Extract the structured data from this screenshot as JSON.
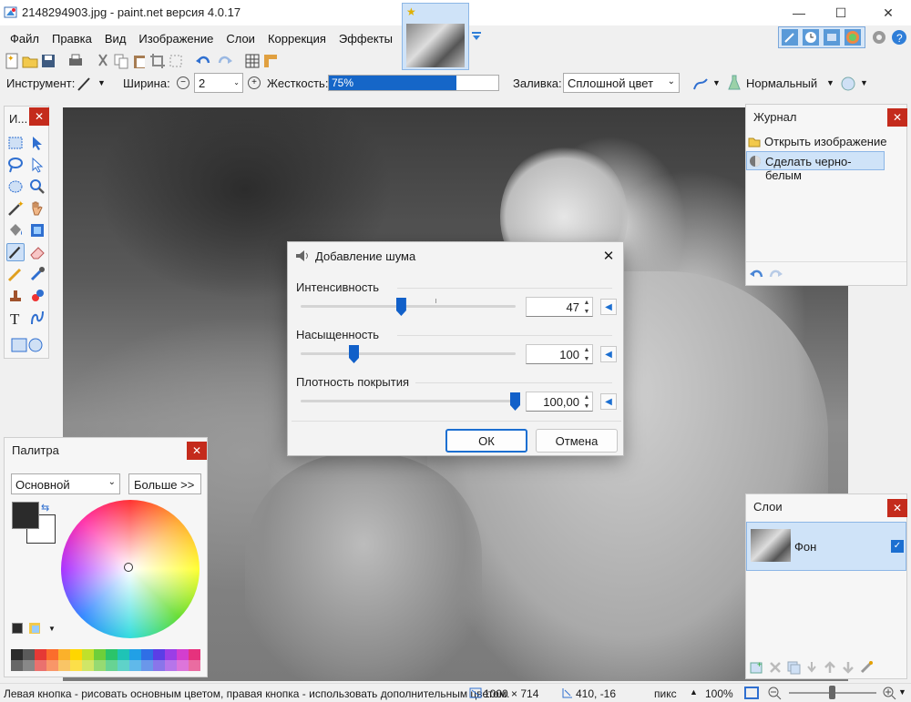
{
  "window": {
    "title": "2148294903.jpg - paint.net версия 4.0.17",
    "min": "—",
    "max": "☐",
    "close": "✕"
  },
  "menu": [
    "Файл",
    "Правка",
    "Вид",
    "Изображение",
    "Слои",
    "Коррекция",
    "Эффекты"
  ],
  "toolbar2": {
    "tool_label": "Инструмент:",
    "width_label": "Ширина:",
    "width_value": "2",
    "hardness_label": "Жесткость:",
    "hardness_value": "75%",
    "hardness_fraction": 0.75,
    "fill_label": "Заливка:",
    "fill_value": "Сплошной цвет",
    "blend_value": "Нормальный"
  },
  "tools_panel": {
    "title": "И...",
    "close": "✕"
  },
  "history": {
    "title": "Журнал",
    "close": "✕",
    "items": [
      "Открыть изображение",
      "Сделать черно-белым"
    ]
  },
  "palette": {
    "title": "Палитра",
    "close": "✕",
    "mode": "Основной",
    "more": "Больше >>",
    "colors": [
      "#2b2b2b",
      "#5a5a5a",
      "#e53935",
      "#fb6d2c",
      "#fbb12a",
      "#ffd600",
      "#c0e02b",
      "#6ecf3a",
      "#2bc46a",
      "#1fc3b6",
      "#21a0e6",
      "#2f6fe6",
      "#5b3ee6",
      "#9b3ee6",
      "#d33ecf",
      "#e6327d"
    ]
  },
  "layers": {
    "title": "Слои",
    "close": "✕",
    "items": [
      {
        "name": "Фон",
        "visible": true
      }
    ]
  },
  "dialog": {
    "title": "Добавление шума",
    "close": "✕",
    "params": [
      {
        "label": "Интенсивность",
        "value": "47",
        "fraction": 0.47
      },
      {
        "label": "Насыщенность",
        "value": "100",
        "fraction": 0.25
      },
      {
        "label": "Плотность покрытия",
        "value": "100,00",
        "fraction": 1.0
      }
    ],
    "ok": "ОК",
    "cancel": "Отмена"
  },
  "status": {
    "hint": "Левая кнопка - рисовать основным цветом, правая кнопка - использовать дополнительным цветом.",
    "size": "1000 × 714",
    "pos": "410, -16",
    "units": "пикс",
    "zoom": "100%"
  }
}
